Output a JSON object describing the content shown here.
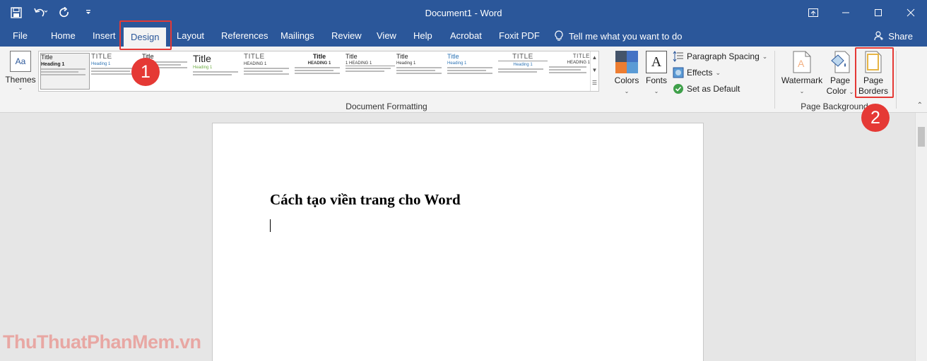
{
  "window": {
    "title": "Document1  -  Word",
    "controls": [
      "ribbon-display-options",
      "minimize",
      "maximize",
      "close"
    ]
  },
  "quick_access": [
    "save-icon",
    "undo-icon",
    "redo-icon",
    "customize-qat-icon"
  ],
  "tabs": [
    {
      "label": "File"
    },
    {
      "label": "Home"
    },
    {
      "label": "Insert"
    },
    {
      "label": "Design",
      "active": true
    },
    {
      "label": "Layout"
    },
    {
      "label": "References"
    },
    {
      "label": "Mailings"
    },
    {
      "label": "Review"
    },
    {
      "label": "View"
    },
    {
      "label": "Help"
    },
    {
      "label": "Acrobat"
    },
    {
      "label": "Foxit PDF"
    }
  ],
  "tell_me": "Tell me what you want to do",
  "share": "Share",
  "ribbon": {
    "themes_label": "Themes",
    "gallery": [
      {
        "title": "Title",
        "heading": "Heading 1",
        "style": "plain",
        "selected": true
      },
      {
        "title": "TITLE",
        "heading": "Heading 1",
        "style": "caps"
      },
      {
        "title": "Title",
        "heading": "",
        "style": "plain"
      },
      {
        "title": "Title",
        "heading": "Heading 1",
        "style": "big"
      },
      {
        "title": "TITLE",
        "heading": "HEADING 1",
        "style": "caps"
      },
      {
        "title": "Title",
        "heading": "HEADING 1",
        "style": "plain"
      },
      {
        "title": "Title",
        "heading": "1  HEADING 1",
        "style": "plain"
      },
      {
        "title": "Title",
        "heading": "Heading 1",
        "style": "plain"
      },
      {
        "title": "Title",
        "heading": "Heading 1",
        "style": "plain"
      },
      {
        "title": "TITLE",
        "heading": "Heading 1",
        "style": "caps"
      },
      {
        "title": "TITLE",
        "heading": "HEADING 1",
        "style": "caps"
      }
    ],
    "colors_label": "Colors",
    "fonts_label": "Fonts",
    "paragraph_spacing": "Paragraph Spacing",
    "effects": "Effects",
    "set_as_default": "Set as Default",
    "document_formatting_label": "Document Formatting",
    "watermark_label": "Watermark",
    "page_color_label_1": "Page",
    "page_color_label_2": "Color",
    "page_borders_label_1": "Page",
    "page_borders_label_2": "Borders",
    "page_background_label": "Page Background"
  },
  "document": {
    "heading": "Cách tạo viền trang cho Word"
  },
  "annotations": {
    "step1": "1",
    "step2": "2"
  },
  "watermark_site": "ThuThuatPhanMem.vn"
}
